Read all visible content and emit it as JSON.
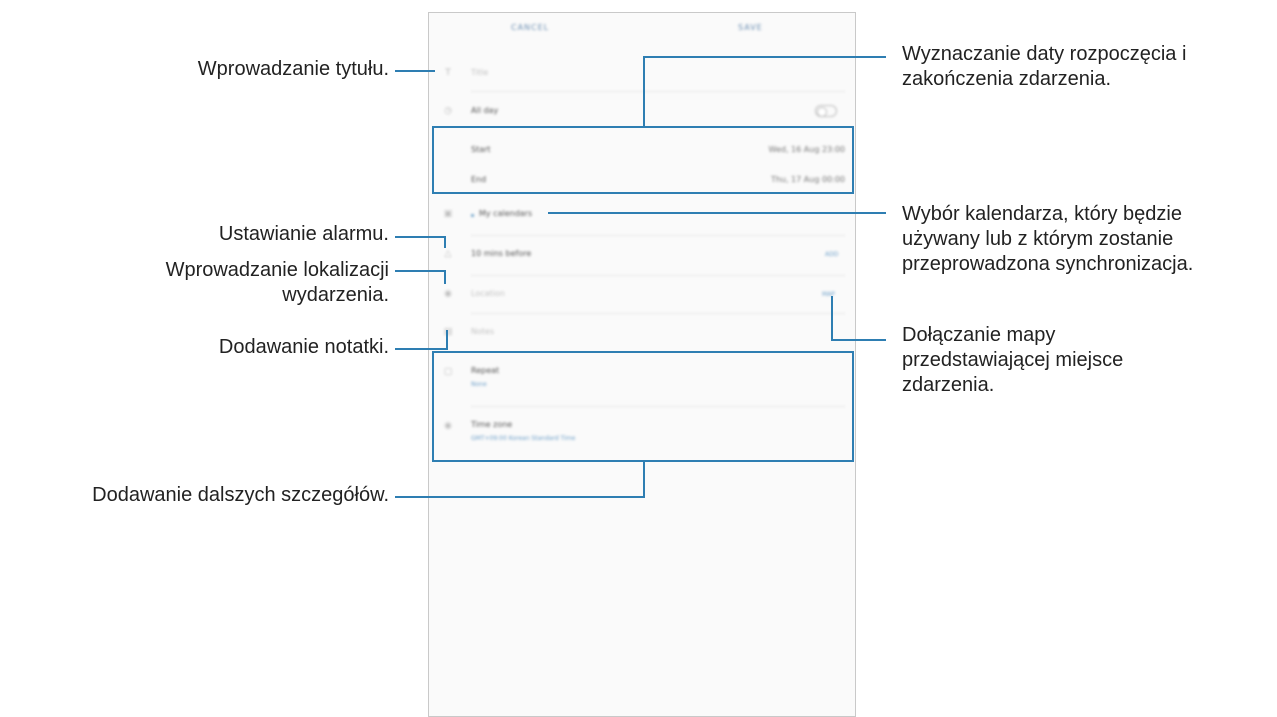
{
  "form": {
    "cancel_label": "CANCEL",
    "save_label": "SAVE",
    "title_placeholder": "Title",
    "all_day_label": "All day",
    "start_label": "Start",
    "start_value": "Wed, 16 Aug  23:00",
    "end_label": "End",
    "end_value": "Thu, 17 Aug  00:00",
    "calendar_label": "My calendars",
    "alarm_label": "10 mins before",
    "alarm_action": "ADD",
    "location_placeholder": "Location",
    "map_action": "MAP",
    "notes_placeholder": "Notes",
    "repeat_label": "Repeat",
    "repeat_value": "None",
    "timezone_label": "Time zone",
    "timezone_value": "GMT+09:00 Korean Standard Time"
  },
  "callouts": {
    "title": "Wprowadzanie tytułu.",
    "dates_line1": "Wyznaczanie daty rozpoczęcia i",
    "dates_line2": "zakończenia zdarzenia.",
    "calendar_line1": "Wybór kalendarza, który będzie",
    "calendar_line2": "używany lub z którym zostanie",
    "calendar_line3": "przeprowadzona synchronizacja.",
    "alarm": "Ustawianie alarmu.",
    "location_line1": "Wprowadzanie lokalizacji",
    "location_line2": "wydarzenia.",
    "map_line1": "Dołączanie mapy",
    "map_line2": "przedstawiającej miejsce",
    "map_line3": "zdarzenia.",
    "notes": "Dodawanie notatki.",
    "details": "Dodawanie dalszych szczegółów."
  },
  "colors": {
    "accent": "#2e7eb2",
    "link_blue": "#6c9fc9"
  }
}
